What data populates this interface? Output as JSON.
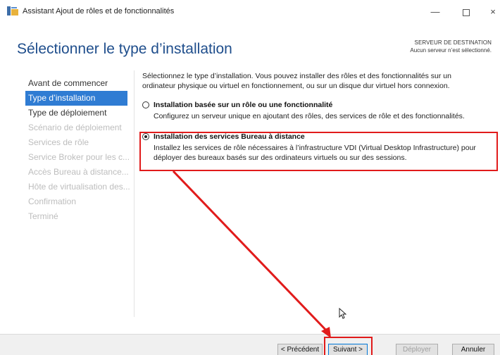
{
  "window": {
    "title": "Assistant Ajout de rôles et de fonctionnalités",
    "app_icon": "server-manager-icon",
    "controls": {
      "minimize": "—",
      "close": "×"
    }
  },
  "header": {
    "page_title": "Sélectionner le type d’installation",
    "destination_title": "SERVEUR DE DESTINATION",
    "destination_sub": "Aucun serveur n’est sélectionné."
  },
  "nav": {
    "items": [
      {
        "label": "Avant de commencer",
        "state": "normal"
      },
      {
        "label": "Type d’installation",
        "state": "selected"
      },
      {
        "label": "Type de déploiement",
        "state": "normal"
      },
      {
        "label": "Scénario de déploiement",
        "state": "disabled"
      },
      {
        "label": "Services de rôle",
        "state": "disabled"
      },
      {
        "label": "Service Broker pour les c...",
        "state": "disabled"
      },
      {
        "label": "Accès Bureau à distance...",
        "state": "disabled"
      },
      {
        "label": "Hôte de virtualisation des...",
        "state": "disabled"
      },
      {
        "label": "Confirmation",
        "state": "disabled"
      },
      {
        "label": "Terminé",
        "state": "disabled"
      }
    ]
  },
  "main": {
    "intro": "Sélectionnez le type d’installation. Vous pouvez installer des rôles et des fonctionnalités sur un ordinateur physique ou virtuel en fonctionnement, ou sur un disque dur virtuel hors connexion.",
    "options": [
      {
        "label": "Installation basée sur un rôle ou une fonctionnalité",
        "description": "Configurez un serveur unique en ajoutant des rôles, des services de rôle et des fonctionnalités.",
        "checked": false
      },
      {
        "label": "Installation des services Bureau à distance",
        "description": "Installez les services de rôle nécessaires à l’infrastructure VDI (Virtual Desktop Infrastructure) pour déployer des bureaux basés sur des ordinateurs virtuels ou sur des sessions.",
        "checked": true
      }
    ]
  },
  "footer": {
    "prev_label": "< Précédent",
    "next_label": "Suivant >",
    "deploy_label": "Déployer",
    "cancel_label": "Annuler"
  },
  "colors": {
    "accent": "#2f7cd3",
    "title": "#1f4e8c",
    "annotation_red": "#e11b1b"
  }
}
